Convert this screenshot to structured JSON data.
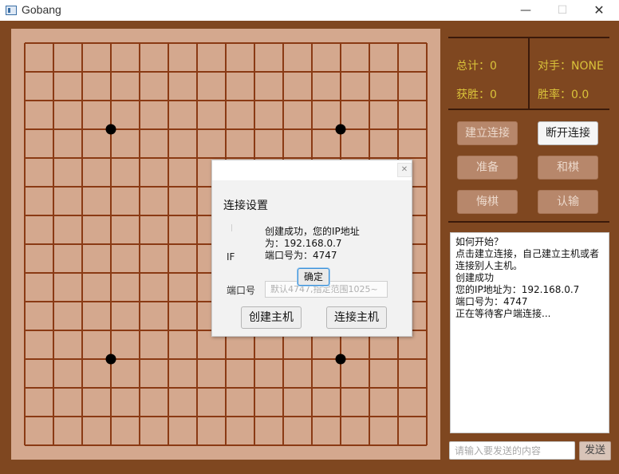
{
  "window": {
    "title": "Gobang",
    "minimize": "—",
    "maximize": "☐",
    "close": "✕"
  },
  "board": {
    "grid_size": 15,
    "stones": [
      {
        "col": 3,
        "row": 3,
        "color": "black"
      },
      {
        "col": 11,
        "row": 3,
        "color": "black"
      },
      {
        "col": 3,
        "row": 11,
        "color": "black"
      },
      {
        "col": 11,
        "row": 11,
        "color": "black"
      }
    ]
  },
  "stats": {
    "total": "总计：0",
    "opponent": "对手：NONE",
    "wins": "获胜：0",
    "win_rate": "胜率：0.0"
  },
  "buttons": {
    "connect": "建立连接",
    "disconnect": "断开连接",
    "ready": "准备",
    "draw": "和棋",
    "undo": "悔棋",
    "surrender": "认输"
  },
  "chat": {
    "lines": [
      "如何开始？",
      "点击建立连接，自己建立主机或者",
      "连接别人主机。",
      "创建成功",
      "您的IP地址为：192.168.0.7",
      "端口号为：4747",
      "正在等待客户端连接..."
    ],
    "input_placeholder": "请输入要发送的内容",
    "send_label": "发送"
  },
  "dialog": {
    "title": "连接设置",
    "message_lines": [
      "创建成功，您的IP地址",
      "为：192.168.0.7",
      "端口号为：4747"
    ],
    "ok_label": "确定",
    "ip_label_partial": "IF",
    "port_label_partial": "端口号",
    "port_placeholder": "默认4747,指定范围1025~",
    "create_host_label": "创建主机",
    "connect_host_label": "连接主机",
    "close_glyph": "✕"
  },
  "colors": {
    "frame": "#7f4720",
    "board": "#d4a88e",
    "grid_line": "#8a3a14",
    "stat_text": "#d9c23a"
  }
}
